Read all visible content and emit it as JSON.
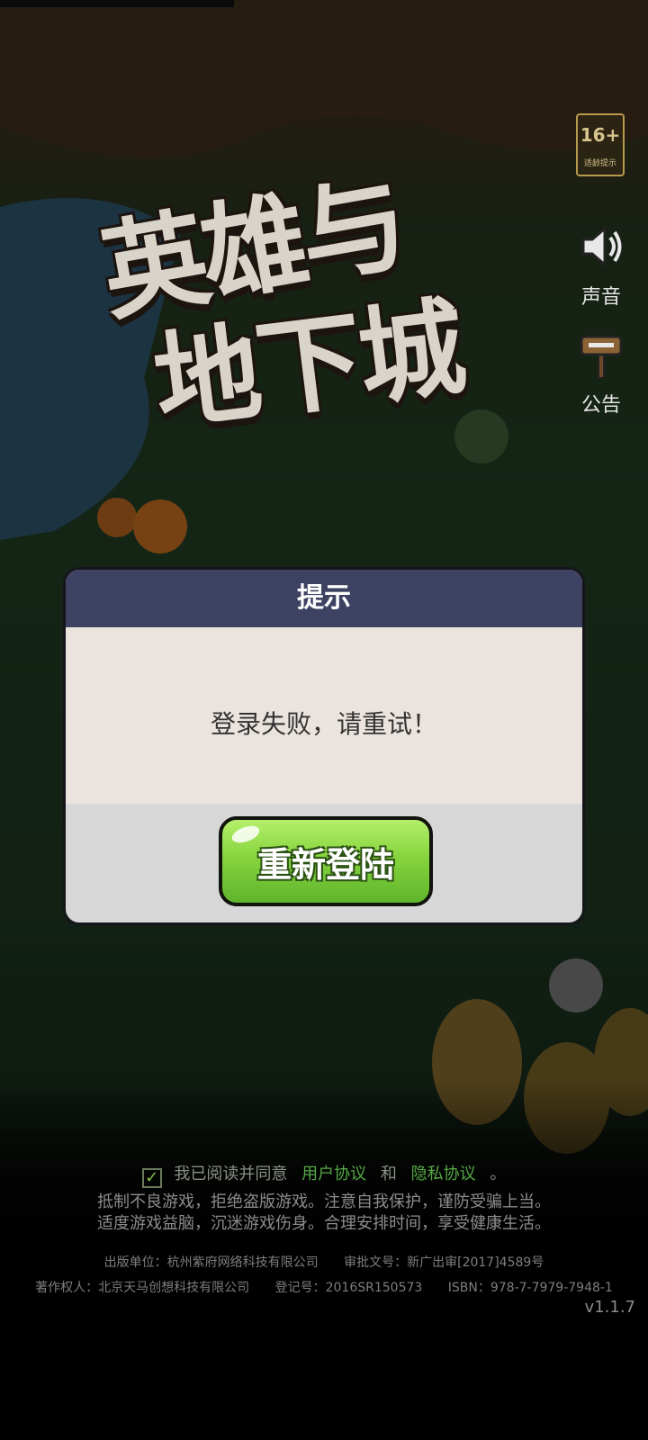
{
  "game": {
    "logo_line1": "英雄与",
    "logo_line2": "地下城"
  },
  "age_rating": {
    "value": "16+",
    "label": "适龄提示"
  },
  "side_menu": {
    "sound_label": "声音",
    "notice_label": "公告"
  },
  "dialog": {
    "title": "提示",
    "message": "登录失败，请重试！",
    "button_label": "重新登陆"
  },
  "agreement": {
    "checked": true,
    "prefix": "我已阅读并同意",
    "user_agreement": "用户协议",
    "and": "和",
    "privacy_agreement": "隐私协议",
    "suffix": "。"
  },
  "health_notice": {
    "line1": "抵制不良游戏，拒绝盗版游戏。注意自我保护，谨防受骗上当。",
    "line2": "适度游戏益脑，沉迷游戏伤身。合理安排时间，享受健康生活。"
  },
  "credits": {
    "publisher": "出版单位：杭州紫府网络科技有限公司",
    "approval": "审批文号：新广出审[2017]4589号",
    "copyright": "著作权人：北京天马创想科技有限公司",
    "registration": "登记号：2016SR150573",
    "isbn": "ISBN：978-7-7979-7948-1"
  },
  "version": "v1.1.7",
  "colors": {
    "dialog_header": "#3d4262",
    "dialog_body": "#ebe4de",
    "button_green": "#86d43e",
    "link_green": "#55a845"
  }
}
